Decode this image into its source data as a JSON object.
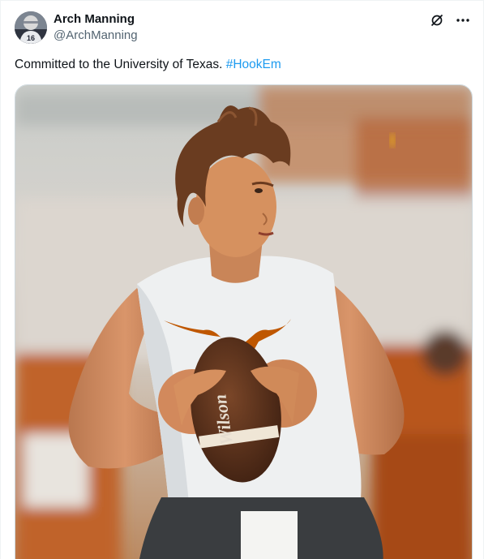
{
  "author": {
    "display_name": "Arch Manning",
    "handle": "@ArchManning",
    "avatar_jersey_number": "16"
  },
  "tweet": {
    "text": "Committed to the University of Texas. ",
    "hashtag": "#HookEm"
  },
  "media": {
    "jersey_logo": "longhorn",
    "football_brand": "Wilson",
    "colors": {
      "burnt_orange": "#bf5700",
      "link_blue": "#1d9bf0"
    }
  },
  "icons": {
    "grok": "grok-icon",
    "more": "more-icon"
  }
}
